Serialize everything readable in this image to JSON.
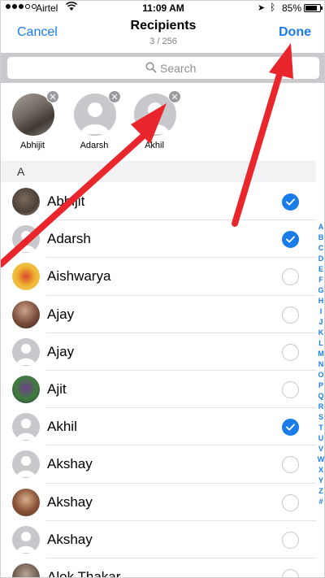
{
  "status_bar": {
    "carrier": "Airtel",
    "time": "11:09 AM",
    "battery": "85%",
    "battery_level": 0.85
  },
  "nav": {
    "cancel_label": "Cancel",
    "title": "Recipients",
    "subtitle": "3 / 256",
    "done_label": "Done"
  },
  "search": {
    "placeholder": "Search"
  },
  "selected": [
    {
      "name": "Abhijit",
      "has_photo": true
    },
    {
      "name": "Adarsh",
      "has_photo": false
    },
    {
      "name": "Akhil",
      "has_photo": false
    }
  ],
  "section_header": "A",
  "contacts": [
    {
      "name": "Abhijit",
      "checked": true,
      "avatar": "photo"
    },
    {
      "name": "Adarsh",
      "checked": true,
      "avatar": "placeholder"
    },
    {
      "name": "Aishwarya",
      "checked": false,
      "avatar": "photo"
    },
    {
      "name": "Ajay",
      "checked": false,
      "avatar": "photo"
    },
    {
      "name": "Ajay",
      "checked": false,
      "avatar": "placeholder"
    },
    {
      "name": "Ajit",
      "checked": false,
      "avatar": "photo"
    },
    {
      "name": "Akhil",
      "checked": true,
      "avatar": "placeholder"
    },
    {
      "name": "Akshay",
      "checked": false,
      "avatar": "placeholder"
    },
    {
      "name": "Akshay",
      "checked": false,
      "avatar": "photo"
    },
    {
      "name": "Akshay",
      "checked": false,
      "avatar": "placeholder"
    },
    {
      "name": "Alok Thakar",
      "checked": false,
      "avatar": "photo"
    }
  ],
  "index_letters": [
    "A",
    "B",
    "C",
    "D",
    "E",
    "F",
    "G",
    "H",
    "I",
    "J",
    "K",
    "L",
    "M",
    "N",
    "O",
    "P",
    "Q",
    "R",
    "S",
    "T",
    "U",
    "V",
    "W",
    "X",
    "Y",
    "Z",
    "#"
  ],
  "colors": {
    "accent": "#1a7ce8",
    "annotation_arrow": "#e8262c"
  }
}
